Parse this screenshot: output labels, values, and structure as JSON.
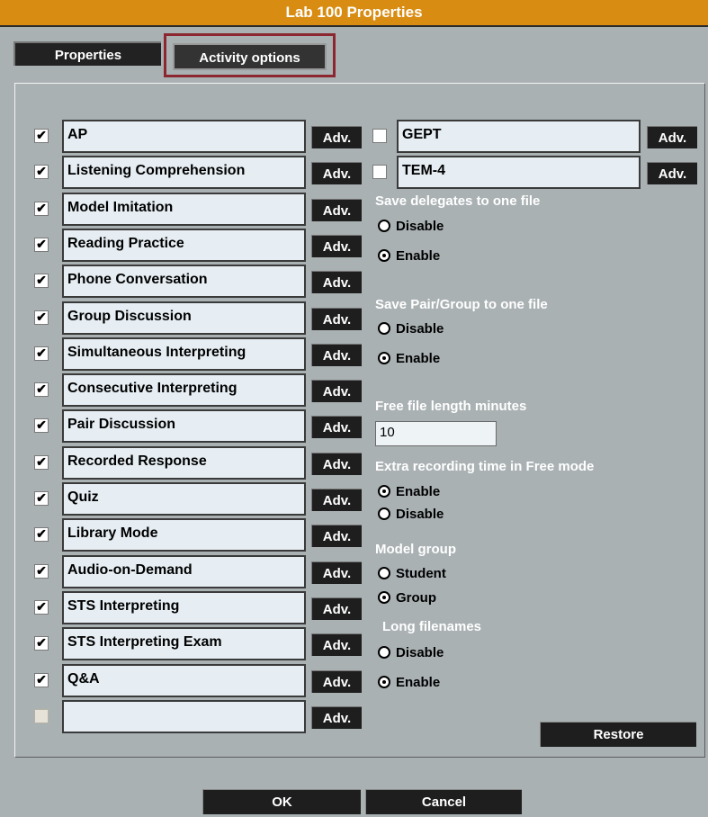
{
  "window": {
    "title": "Lab 100 Properties"
  },
  "tabs": {
    "properties": "Properties",
    "activity_options": "Activity options"
  },
  "activities_left": [
    {
      "label": "AP",
      "checked": true
    },
    {
      "label": "Listening Comprehension",
      "checked": true
    },
    {
      "label": "Model Imitation",
      "checked": true
    },
    {
      "label": "Reading Practice",
      "checked": true
    },
    {
      "label": "Phone Conversation",
      "checked": true
    },
    {
      "label": "Group Discussion",
      "checked": true
    },
    {
      "label": "Simultaneous Interpreting",
      "checked": true
    },
    {
      "label": "Consecutive Interpreting",
      "checked": true
    },
    {
      "label": "Pair Discussion",
      "checked": true
    },
    {
      "label": "Recorded Response",
      "checked": true
    },
    {
      "label": "Quiz",
      "checked": true
    },
    {
      "label": "Library Mode",
      "checked": true
    },
    {
      "label": "Audio-on-Demand",
      "checked": true
    },
    {
      "label": "STS Interpreting",
      "checked": true
    },
    {
      "label": "STS Interpreting Exam",
      "checked": true
    },
    {
      "label": "Q&A",
      "checked": true
    },
    {
      "label": "",
      "checked": false,
      "disabled": true
    }
  ],
  "activities_right": [
    {
      "label": "GEPT",
      "checked": false
    },
    {
      "label": "TEM-4",
      "checked": false
    }
  ],
  "adv_label": "Adv.",
  "check_mark": "✔",
  "save_delegates": {
    "title": "Save delegates to one file",
    "disable": "Disable",
    "enable": "Enable",
    "selected": "enable"
  },
  "save_pair": {
    "title": "Save Pair/Group to one file",
    "disable": "Disable",
    "enable": "Enable",
    "selected": "enable"
  },
  "free_file": {
    "title": "Free file length minutes",
    "value": "10"
  },
  "extra_recording": {
    "title": "Extra recording time in Free mode",
    "enable": "Enable",
    "disable": "Disable",
    "selected": "enable"
  },
  "model_group": {
    "title": "Model group",
    "student": "Student",
    "group": "Group",
    "selected": "group"
  },
  "long_filenames": {
    "title": "Long filenames",
    "disable": "Disable",
    "enable": "Enable",
    "selected": "enable"
  },
  "buttons": {
    "restore": "Restore",
    "ok": "OK",
    "cancel": "Cancel"
  }
}
